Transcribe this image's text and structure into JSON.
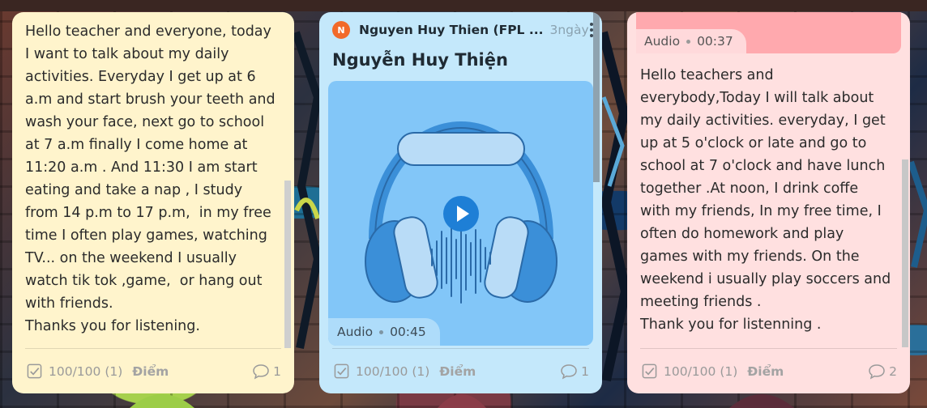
{
  "colors": {
    "card_yellow": "#fff4cc",
    "card_blue": "#c4e8fb",
    "card_pink": "#ffe0e0",
    "avatar": "#f26a2a",
    "play_button": "#1e7fd6"
  },
  "cards": [
    {
      "body": "Hello teacher and everyone, today\nI want to talk about my daily\nactivities. Everyday I get up at 6\na.m and start brush your teeth and\nwash your face, next go to school\nat 7 a.m finally I come home at\n11:20 a.m . And 11:30 I am start\neating and take a nap , I study\nfrom 14 p.m to 17 p.m,  in my free\ntime I often play games, watching\nTV... on the weekend I usually\nwatch tik tok ,game,  or hang out\nwith friends.\nThanks you for listening.",
      "score": "100/100 (1)",
      "score_label": "Điểm",
      "comment_count": "1"
    },
    {
      "avatar_letter": "N",
      "author": "Nguyen Huy Thien (FPL ...",
      "time": "3ngày",
      "title": "Nguyễn Huy Thiện",
      "audio_label": "Audio",
      "audio_duration": "00:45",
      "score": "100/100 (1)",
      "score_label": "Điểm",
      "comment_count": "1"
    },
    {
      "audio_label": "Audio",
      "audio_duration": "00:37",
      "body": "Hello teachers and\neverybody,Today I will talk about\nmy daily activities. everyday, I get\nup at 5 o'clock or late and go to\nschool at 7 o'clock and have lunch\ntogether .At noon, I drink coffe\nwith my friends, In my free time, I\noften do homework and play\ngames with my friends. On the\nweekend i usually play soccers and\nmeeting friends .\nThank you for listenning .",
      "score": "100/100 (1)",
      "score_label": "Điểm",
      "comment_count": "2"
    }
  ]
}
